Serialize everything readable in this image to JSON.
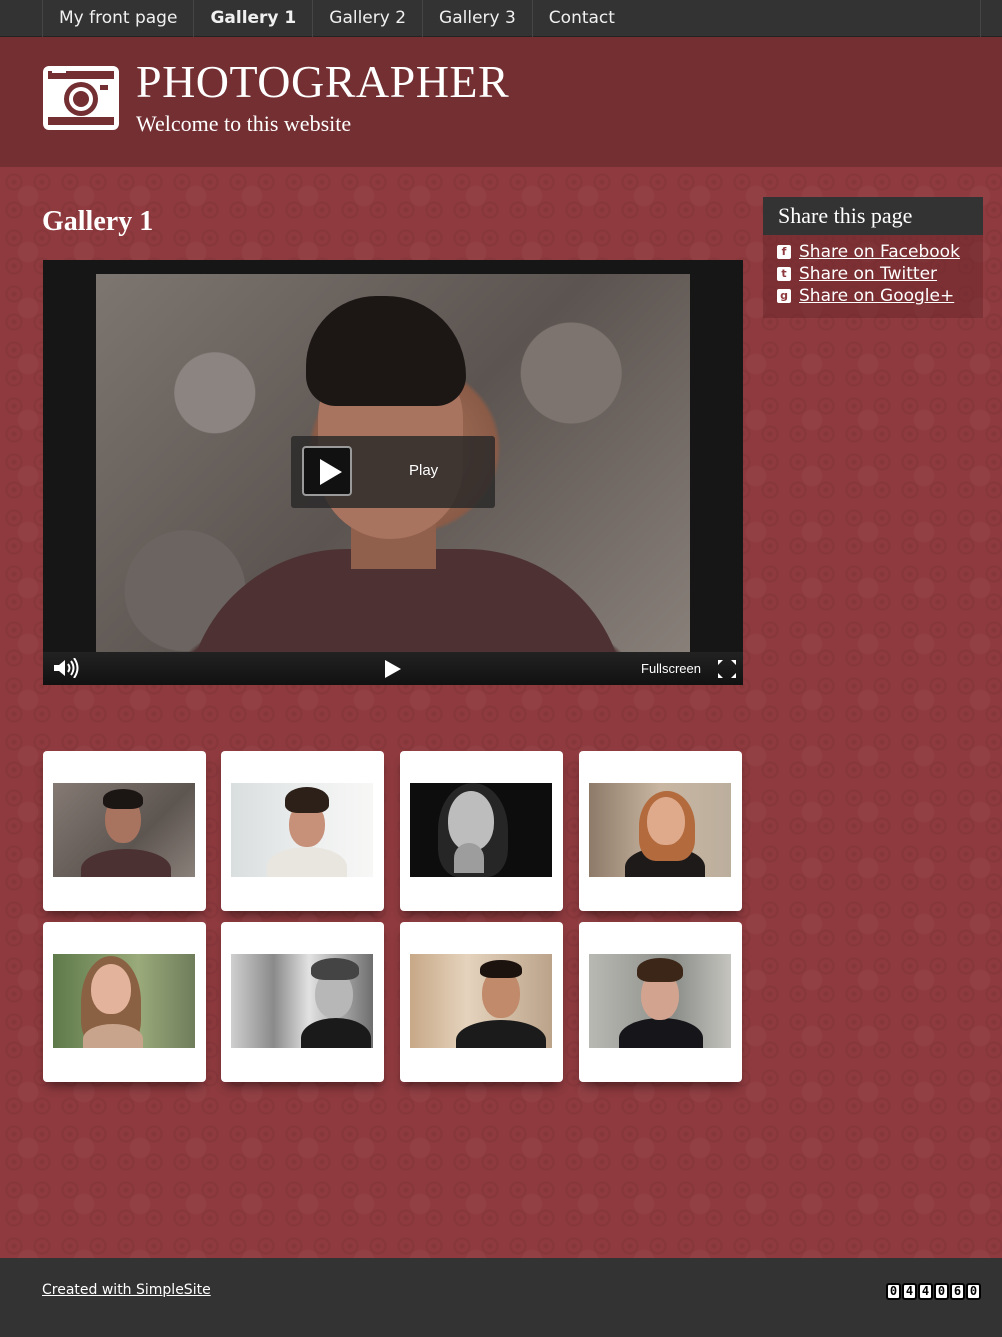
{
  "nav": {
    "items": [
      {
        "label": "My front page",
        "active": false
      },
      {
        "label": "Gallery 1",
        "active": true
      },
      {
        "label": "Gallery 2",
        "active": false
      },
      {
        "label": "Gallery 3",
        "active": false
      },
      {
        "label": "Contact",
        "active": false
      }
    ]
  },
  "header": {
    "title": "PHOTOGRAPHER",
    "subtitle": "Welcome to this website",
    "logo_icon": "camera-icon"
  },
  "main": {
    "heading": "Gallery 1",
    "video": {
      "play_label": "Play",
      "fullscreen_label": "Fullscreen",
      "icons": [
        "volume-icon",
        "play-icon",
        "fullscreen-icon"
      ]
    },
    "gallery": [
      {
        "subject": "man-wall"
      },
      {
        "subject": "woman-smiling"
      },
      {
        "subject": "woman-bw"
      },
      {
        "subject": "woman-redhead"
      },
      {
        "subject": "girl-longhair"
      },
      {
        "subject": "woman-beanie-bw"
      },
      {
        "subject": "man-smiling"
      },
      {
        "subject": "boy-hoodie"
      }
    ]
  },
  "sidebar": {
    "share_title": "Share this page",
    "links": [
      {
        "label": "Share on Facebook",
        "icon": "facebook-icon",
        "glyph": "f"
      },
      {
        "label": "Share on Twitter",
        "icon": "twitter-icon",
        "glyph": "t"
      },
      {
        "label": "Share on Google+",
        "icon": "googleplus-icon",
        "glyph": "g"
      }
    ]
  },
  "footer": {
    "credit": "Created with SimpleSite",
    "counter_digits": [
      "0",
      "4",
      "4",
      "0",
      "6",
      "0"
    ]
  },
  "colors": {
    "background": "#8e3a3e",
    "header": "#732f32",
    "nav": "#333333",
    "footer": "#333333"
  }
}
